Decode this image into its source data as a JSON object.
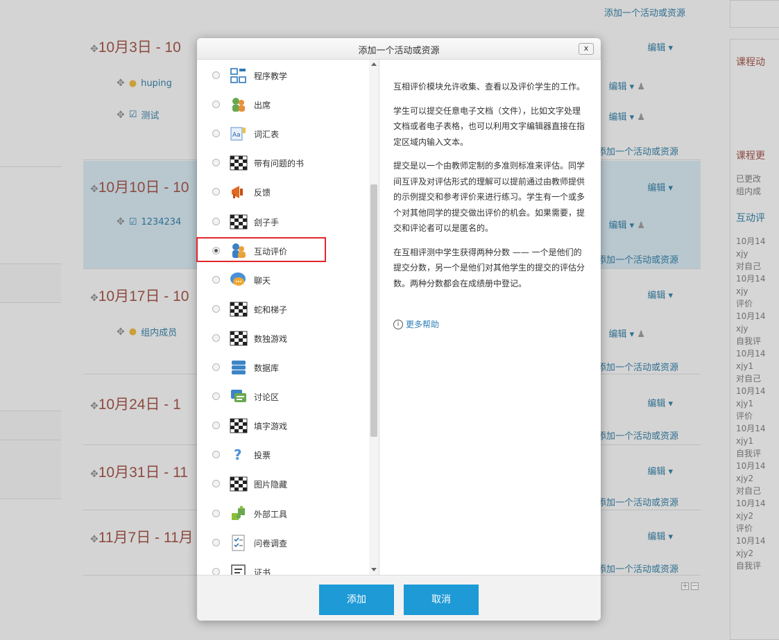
{
  "background": {
    "top_add_link": "添加一个活动或资源",
    "sections": [
      {
        "title": "10月3日 - 10",
        "edit": "编辑",
        "add": "添加一个活动或资源",
        "activities": [
          {
            "name": "huping",
            "edit": "编辑"
          },
          {
            "name": "测试",
            "edit": "编辑"
          }
        ]
      },
      {
        "title": "10月10日 - 10",
        "edit": "编辑",
        "add": "添加一个活动或资源",
        "activities": [
          {
            "name": "1234234",
            "edit": "编辑"
          }
        ]
      },
      {
        "title": "10月17日 - 10",
        "edit": "编辑",
        "add": "添加一个活动或资源",
        "activities": [
          {
            "name": "组内成员",
            "edit": "编辑"
          }
        ]
      },
      {
        "title": "10月24日 - 1",
        "edit": "编辑",
        "add": "添加一个活动或资源",
        "activities": []
      },
      {
        "title": "10月31日 - 11",
        "edit": "编辑",
        "add": "添加一个活动或资源",
        "activities": []
      },
      {
        "title": "11月7日 - 11月",
        "edit": "编辑",
        "add": "添加一个活动或资源",
        "activities": []
      }
    ],
    "right": {
      "block1_title": "课程动",
      "block2_title": "课程更",
      "block2_line1": "已更改",
      "block2_line2": "组内成",
      "block2_link": "互动评",
      "log": [
        "10月14",
        "xjy",
        "对自己",
        "10月14",
        "xjy",
        "评价",
        "10月14",
        "xjy",
        "自我评",
        "10月14",
        "xjy1",
        "对自己",
        "10月14",
        "xjy1",
        "评价",
        "10月14",
        "xjy1",
        "自我评",
        "10月14",
        "xjy2",
        "对自己",
        "10月14",
        "xjy2",
        "评价",
        "10月14",
        "xjy2",
        "自我评"
      ]
    }
  },
  "modal": {
    "title": "添加一个活动或资源",
    "close_label": "x",
    "options": [
      {
        "label": "程序教学",
        "icon": "lesson-icon",
        "checked": false
      },
      {
        "label": "出席",
        "icon": "attendance-icon",
        "checked": false
      },
      {
        "label": "词汇表",
        "icon": "glossary-icon",
        "checked": false
      },
      {
        "label": "带有问题的书",
        "icon": "checker-icon",
        "checked": false
      },
      {
        "label": "反馈",
        "icon": "megaphone-icon",
        "checked": false
      },
      {
        "label": "刽子手",
        "icon": "checker-icon",
        "checked": false
      },
      {
        "label": "互动评价",
        "icon": "workshop-icon",
        "checked": true
      },
      {
        "label": "聊天",
        "icon": "chat-icon",
        "checked": false
      },
      {
        "label": "蛇和梯子",
        "icon": "checker-icon",
        "checked": false
      },
      {
        "label": "数独游戏",
        "icon": "checker-icon",
        "checked": false
      },
      {
        "label": "数据库",
        "icon": "database-icon",
        "checked": false
      },
      {
        "label": "讨论区",
        "icon": "forum-icon",
        "checked": false
      },
      {
        "label": "填字游戏",
        "icon": "checker-icon",
        "checked": false
      },
      {
        "label": "投票",
        "icon": "question-icon",
        "checked": false
      },
      {
        "label": "图片隐藏",
        "icon": "checker-icon",
        "checked": false
      },
      {
        "label": "外部工具",
        "icon": "puzzle-icon",
        "checked": false
      },
      {
        "label": "问卷调查",
        "icon": "survey-icon",
        "checked": false
      },
      {
        "label": "证书",
        "icon": "certificate-icon",
        "checked": false
      }
    ],
    "description": [
      "互相评价模块允许收集、查看以及评价学生的工作。",
      "学生可以提交任意电子文档（文件），比如文字处理文档或者电子表格，也可以利用文字编辑器直接在指定区域内输入文本。",
      "提交是以一个由教师定制的多准则标准来评估。同学间互评及对评估形式的理解可以提前通过由教师提供的示例提交和参考评价来进行练习。学生有一个或多个对其他同学的提交做出评价的机会。如果需要，提交和评论者可以是匿名的。",
      "在互相评测中学生获得两种分数 —— 一个是他们的提交分数，另一个是他们对其他学生的提交的评估分数。两种分数都会在成绩册中登记。"
    ],
    "help_link": "更多帮助",
    "add_button": "添加",
    "cancel_button": "取消"
  }
}
